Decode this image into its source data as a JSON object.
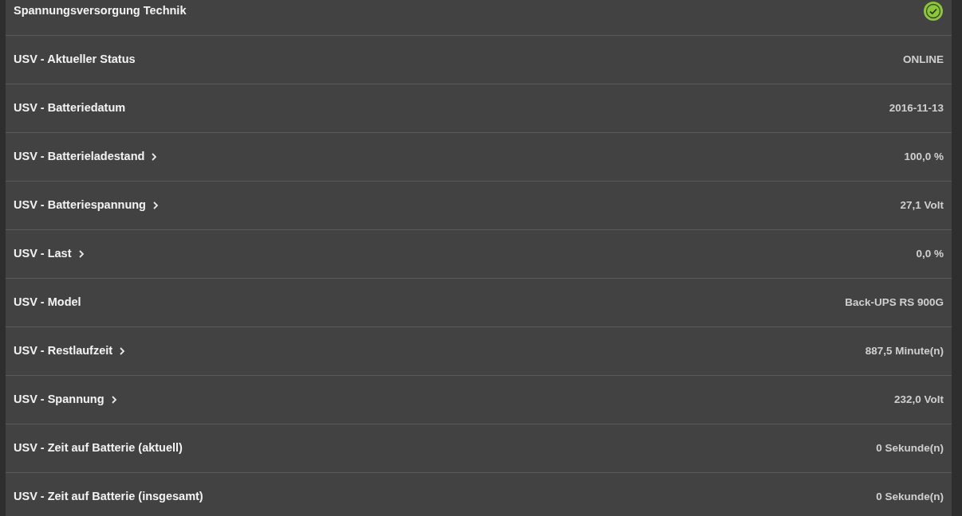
{
  "rows": [
    {
      "label": "Spannungsversorgung Technik",
      "kind": "status",
      "ok": true
    },
    {
      "label": "USV - Aktueller Status",
      "kind": "value",
      "value": "ONLINE",
      "has_details": false
    },
    {
      "label": "USV - Batteriedatum",
      "kind": "value",
      "value": "2016-11-13",
      "has_details": false
    },
    {
      "label": "USV - Batterieladestand",
      "kind": "value",
      "value": "100,0 %",
      "has_details": true
    },
    {
      "label": "USV - Batteriespannung",
      "kind": "value",
      "value": "27,1 Volt",
      "has_details": true
    },
    {
      "label": "USV - Last",
      "kind": "value",
      "value": "0,0 %",
      "has_details": true
    },
    {
      "label": "USV - Model",
      "kind": "value",
      "value": "Back-UPS RS 900G",
      "has_details": false
    },
    {
      "label": "USV - Restlaufzeit",
      "kind": "value",
      "value": "887,5 Minute(n)",
      "has_details": true
    },
    {
      "label": "USV - Spannung",
      "kind": "value",
      "value": "232,0 Volt",
      "has_details": true
    },
    {
      "label": "USV - Zeit auf Batterie (aktuell)",
      "kind": "value",
      "value": "0 Sekunde(n)",
      "has_details": false
    },
    {
      "label": "USV - Zeit auf Batterie (insgesamt)",
      "kind": "value",
      "value": "0 Sekunde(n)",
      "has_details": false
    }
  ]
}
